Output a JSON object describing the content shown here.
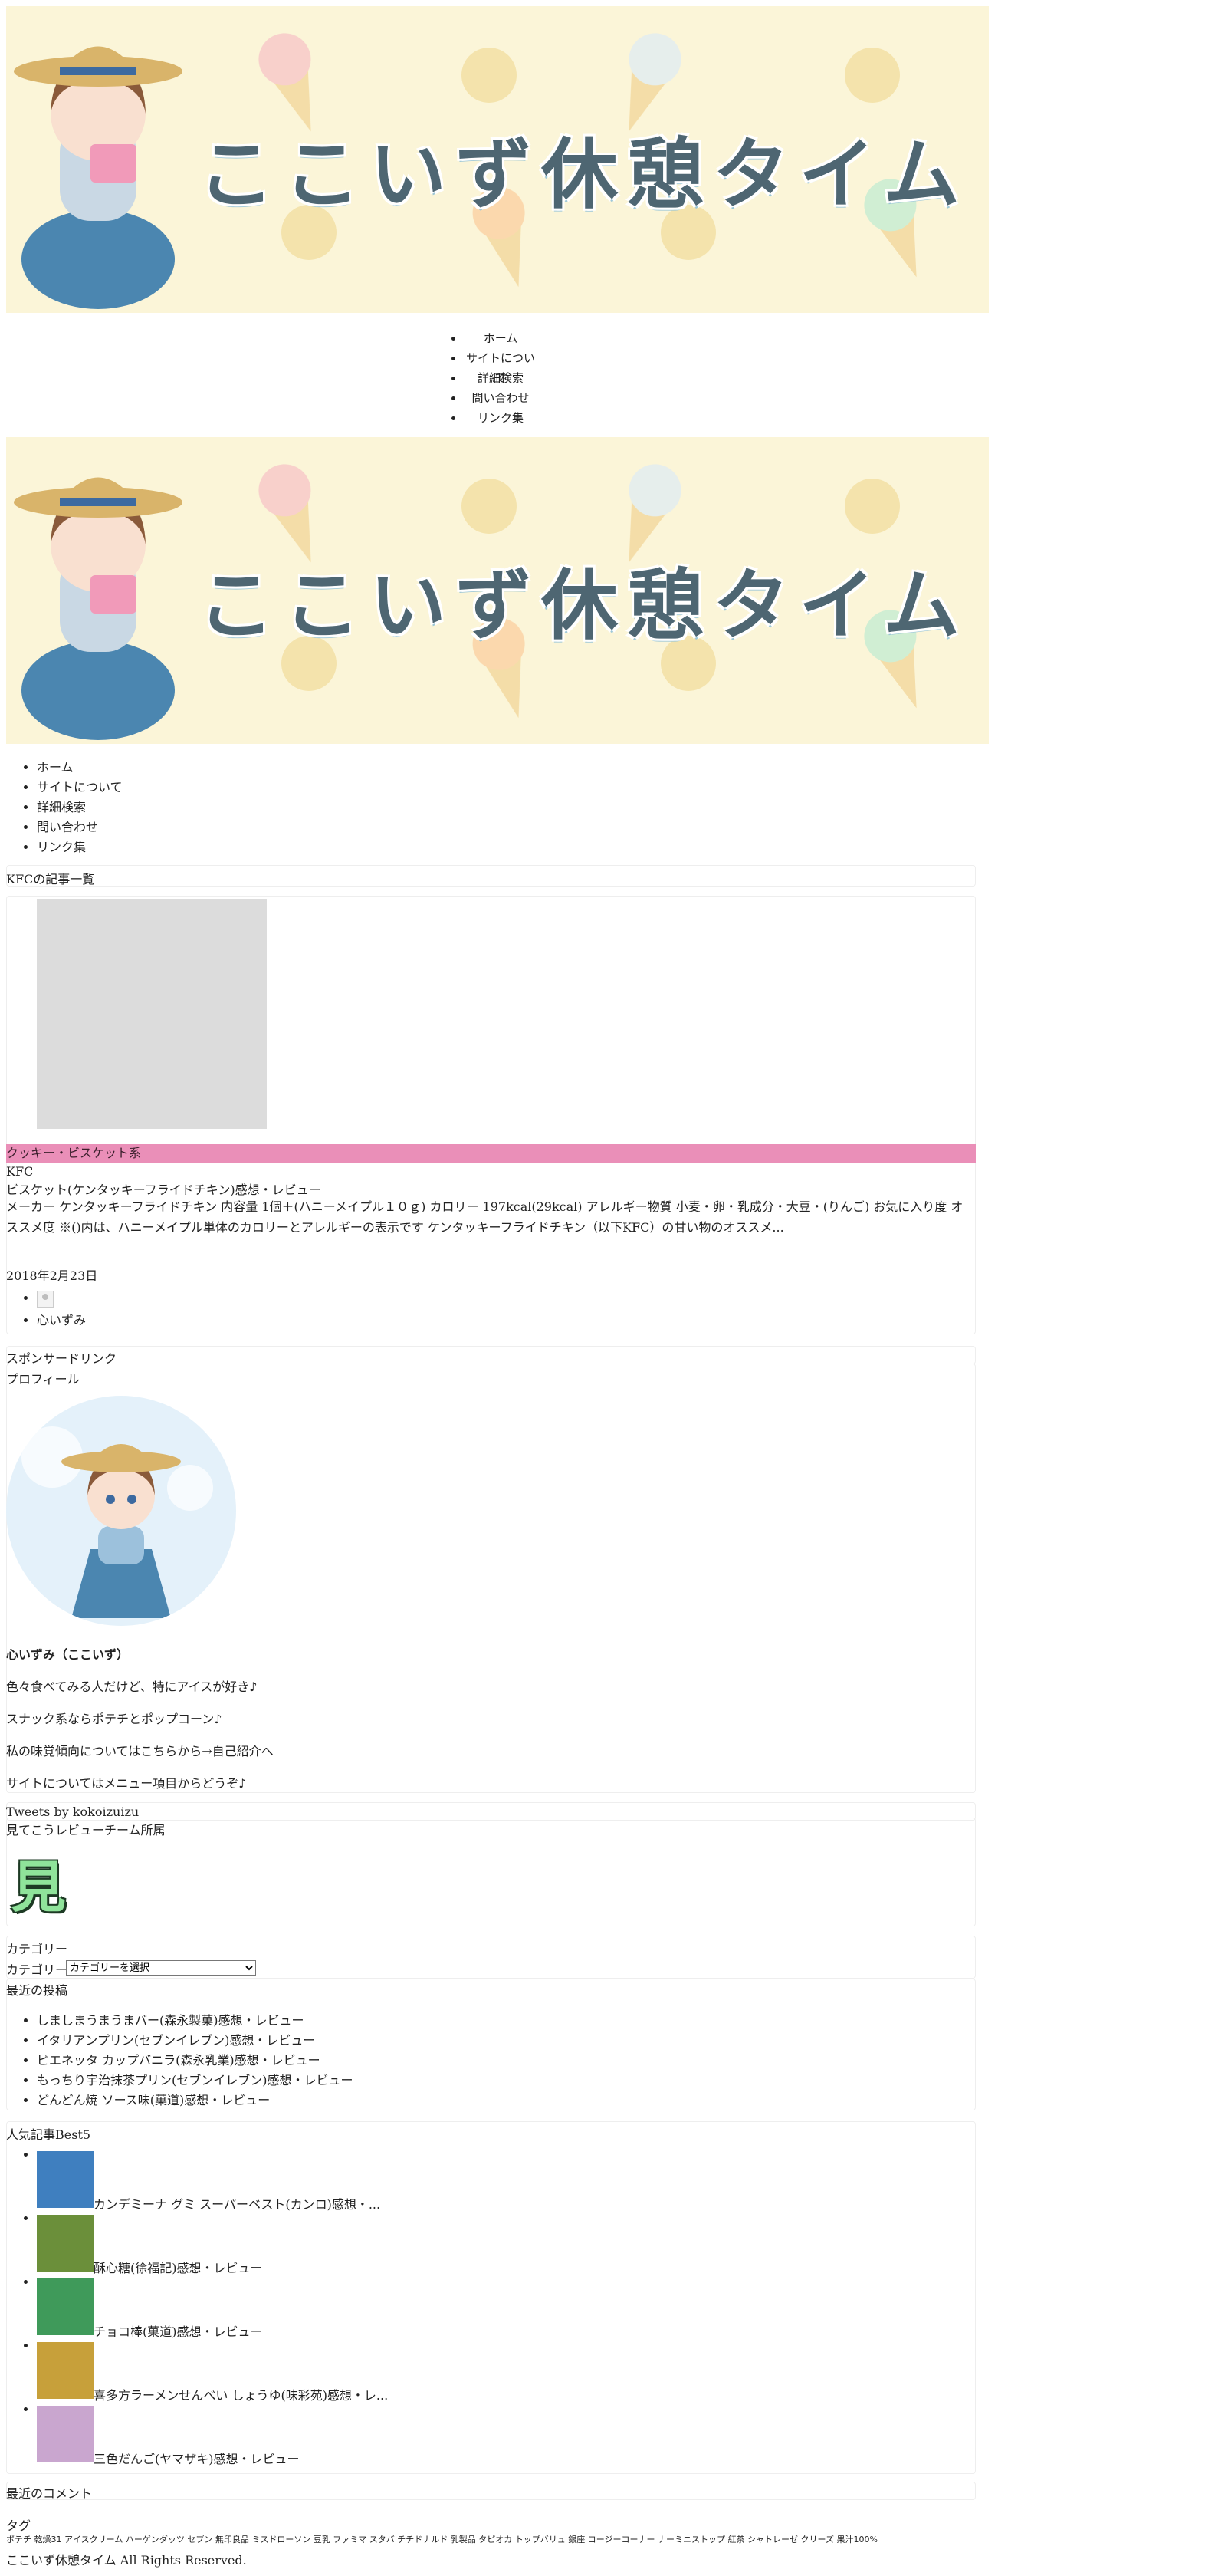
{
  "site": {
    "banner_title": "ここいず休憩タイム",
    "nav": [
      "ホーム",
      "サイトについて",
      "詳細検索",
      "問い合わせ",
      "リンク集"
    ],
    "footer": "ここいず休憩タイム All Rights Reserved."
  },
  "archive": {
    "heading": "KFCの記事一覧",
    "post": {
      "category": "クッキー・ビスケット系",
      "brand": "KFC",
      "title": "ビスケット(ケンタッキーフライドチキン)感想・レビュー",
      "excerpt": "メーカー ケンタッキーフライドチキン 内容量 1個＋(ハニーメイプル１０ｇ) カロリー 197kcal(29kcal) アレルギー物質 小麦・卵・乳成分・大豆・(りんご) お気に入り度 オススメ度 ※()内は、ハニーメイプル単体のカロリーとアレルギーの表示です ケンタッキーフライドチキン（以下KFC）の甘い物のオススメ...",
      "date": "2018年2月23日",
      "author": "心いずみ"
    }
  },
  "sidebar": {
    "sponsor_label": "スポンサードリンク",
    "profile": {
      "heading": "プロフィール",
      "name": "心いずみ（ここいず）",
      "lines": [
        "色々食べてみる人だけど、特にアイスが好き♪",
        "スナック系ならポテチとポップコーン♪",
        "私の味覚傾向についてはこちらから→自己紹介へ",
        "サイトについてはメニュー項目からどうぞ♪"
      ]
    },
    "tweets_label": "Tweets by kokoizuizu",
    "review_team": {
      "heading": "見てこうレビューチーム所属",
      "logo_char": "見"
    },
    "category": {
      "heading": "カテゴリー",
      "label": "カテゴリー",
      "select_value": "カテゴリーを選択"
    },
    "recent_posts": {
      "heading": "最近の投稿",
      "items": [
        "しましまうまうまバー(森永製菓)感想・レビュー",
        "イタリアンプリン(セブンイレブン)感想・レビュー",
        "ピエネッタ カップバニラ(森永乳業)感想・レビュー",
        "もっちり宇治抹茶プリン(セブンイレブン)感想・レビュー",
        "どんどん焼 ソース味(菓道)感想・レビュー"
      ]
    },
    "popular": {
      "heading": "人気記事Best5",
      "items": [
        {
          "label": "カンデミーナ グミ スーパーベスト(カンロ)感想・...",
          "color": "#3f7fbf"
        },
        {
          "label": "酥心糖(徐福記)感想・レビュー",
          "color": "#6b8f3a"
        },
        {
          "label": "チョコ棒(菓道)感想・レビュー",
          "color": "#3f9a5a"
        },
        {
          "label": "喜多方ラーメンせんべい しょうゆ(味彩苑)感想・レ...",
          "color": "#c7a03a"
        },
        {
          "label": "三色だんご(ヤマザキ)感想・レビュー",
          "color": "#c9a6cf"
        }
      ]
    },
    "recent_comments_heading": "最近のコメント",
    "tags": {
      "heading": "タグ",
      "text": "ポテチ 乾燥31 アイスクリーム ハーゲンダッツ セブン 無印良品 ミスドローソン 豆乳 ファミマ スタバ チチドナルド 乳製品 タピオカ トップバリュ 銀座 コージーコーナー ナーミニストップ 紅茶 シャトレーゼ クリーズ 果汁100%"
    }
  }
}
